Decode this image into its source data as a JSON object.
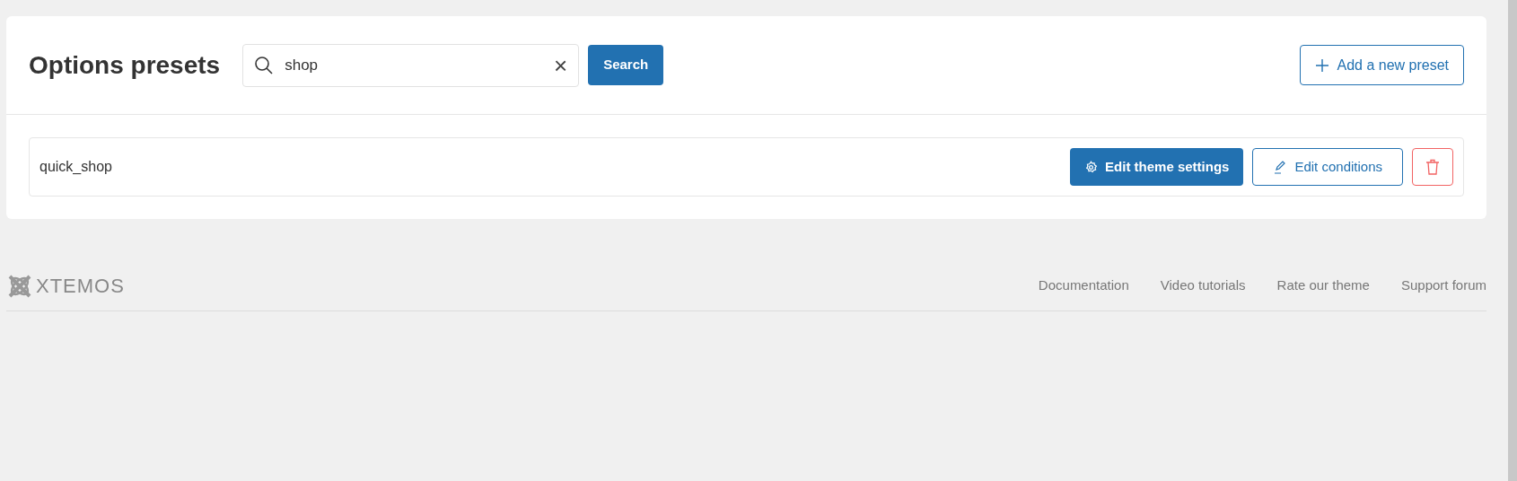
{
  "header": {
    "title": "Options presets",
    "search": {
      "value": "shop",
      "clear": "×"
    },
    "search_button": "Search",
    "add_button": "Add a new preset"
  },
  "presets": [
    {
      "name": "quick_shop",
      "edit_settings": "Edit theme settings",
      "edit_conditions": "Edit conditions"
    }
  ],
  "footer": {
    "logo_text": "XTEMOS",
    "links": [
      "Documentation",
      "Video tutorials",
      "Rate our theme",
      "Support forum"
    ]
  }
}
